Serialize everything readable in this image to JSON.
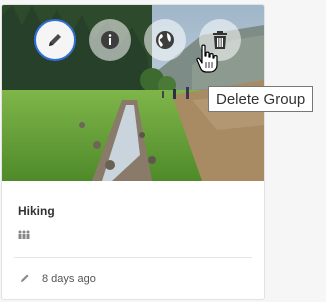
{
  "card": {
    "title": "Hiking",
    "edited": "8 days ago",
    "members_icon": "group-icon",
    "edited_icon": "pencil-icon"
  },
  "actions": [
    {
      "name": "edit",
      "icon": "pencil-icon"
    },
    {
      "name": "info",
      "icon": "info-icon"
    },
    {
      "name": "share",
      "icon": "globe-icon"
    },
    {
      "name": "delete",
      "icon": "trash-icon"
    }
  ],
  "tooltip": {
    "text": "Delete Group"
  },
  "colors": {
    "accent": "#2f6fd6",
    "text": "#333333"
  }
}
